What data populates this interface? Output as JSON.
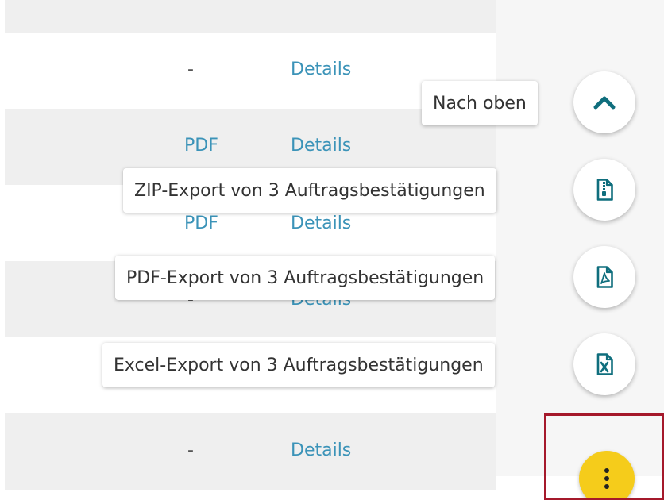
{
  "table": {
    "rows": [
      {
        "dash": "",
        "pdf": "",
        "details": ""
      },
      {
        "dash": "-",
        "pdf": "",
        "details": "Details"
      },
      {
        "dash": "",
        "pdf": "PDF",
        "details": "Details"
      },
      {
        "dash": "",
        "pdf": "PDF",
        "details": "Details"
      },
      {
        "dash": "-",
        "pdf": "",
        "details": "Details"
      },
      {
        "dash": "",
        "pdf": "",
        "details": ""
      },
      {
        "dash": "-",
        "pdf": "",
        "details": "Details"
      }
    ]
  },
  "speed_dial": {
    "scroll_top": {
      "label": "Nach oben",
      "icon": "chevron-up-icon"
    },
    "zip_export": {
      "label": "ZIP-Export von 3 Auftragsbestätigungen",
      "icon": "zip-file-icon"
    },
    "pdf_export": {
      "label": "PDF-Export von 3 Auftragsbestätigungen",
      "icon": "pdf-file-icon"
    },
    "excel_export": {
      "label": "Excel-Export von 3 Auftragsbestätigungen",
      "icon": "excel-file-icon"
    },
    "toggle": {
      "icon": "more-vertical-icon",
      "color": "#f5cc1b"
    },
    "icon_color": "#0f6e7d"
  }
}
